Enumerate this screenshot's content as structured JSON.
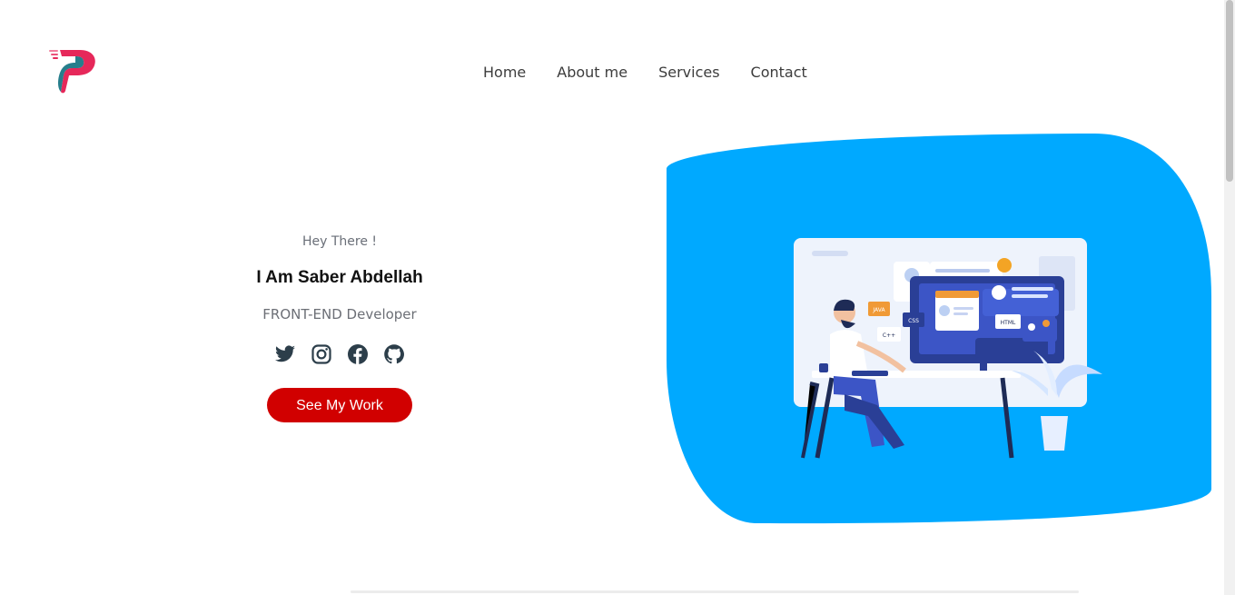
{
  "brand": {
    "logo": "p-letter-logo",
    "colors": {
      "pink": "#e6285a",
      "teal": "#0f7080"
    }
  },
  "nav": {
    "items": [
      {
        "label": "Home"
      },
      {
        "label": "About me"
      },
      {
        "label": "Services"
      },
      {
        "label": "Contact"
      }
    ]
  },
  "hero": {
    "greeting": "Hey There !",
    "name": "I Am Saber Abdellah",
    "role": "FRONT-END Developer",
    "cta_label": "See My Work",
    "socials": [
      "twitter-icon",
      "instagram-icon",
      "facebook-icon",
      "github-icon"
    ],
    "illustration": "developer-at-desk-illustration",
    "illustration_badges": [
      "JAVA",
      "CSS",
      "C++",
      "HTML"
    ]
  },
  "colors": {
    "accent": "#d10000",
    "blob": "#00a9ff",
    "icon": "#2c3e4a"
  }
}
